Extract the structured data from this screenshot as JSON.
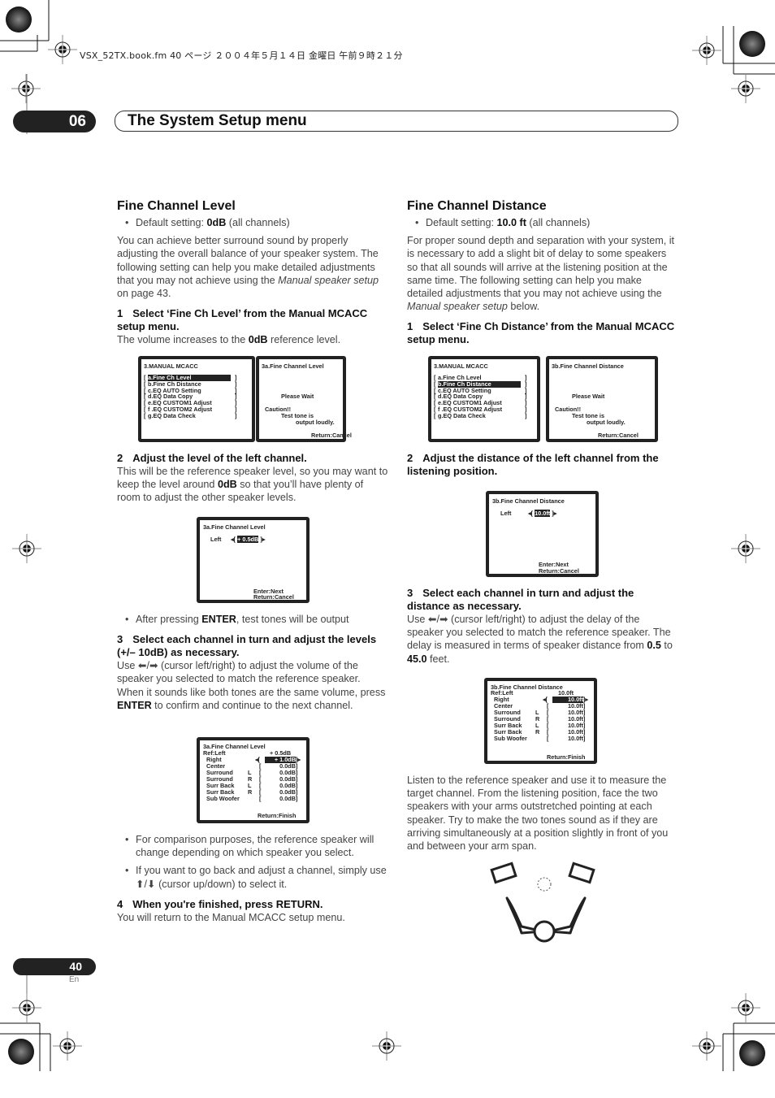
{
  "header": {
    "file_line": "VSX_52TX.book.fm  40 ページ  ２００４年５月１４日  金曜日  午前９時２１分",
    "chapter_number": "06",
    "chapter_title": "The System Setup menu"
  },
  "left": {
    "heading": "Fine Channel Level",
    "default_prefix": "Default setting: ",
    "default_value": "0dB",
    "default_suffix": " (all channels)",
    "intro_a": "You can achieve better surround sound by properly adjusting the overall balance of your speaker system. The following setting can help you make detailed adjustments that you may not achieve using the ",
    "intro_link": "Manual speaker setup",
    "intro_b": " on page 43.",
    "step1_num": "1",
    "step1_title": "Select ‘Fine Ch Level’ from the Manual MCACC setup menu.",
    "step1_a": "The volume increases to the ",
    "step1_bold": "0dB",
    "step1_b": " reference level.",
    "step2_num": "2",
    "step2_title": "Adjust the level of the left channel.",
    "step2_a": "This will be the reference speaker level, so you may want to keep the level around ",
    "step2_bold": "0dB",
    "step2_b": " so that you’ll have plenty of room to adjust the other speaker levels.",
    "bullet_enter_a": "After pressing ",
    "bullet_enter_bold": "ENTER",
    "bullet_enter_b": ", test tones will be output",
    "step3_num": "3",
    "step3_title_a": "Select each channel in turn and adjust the levels ",
    "step3_title_range": "(+/– 10dB)",
    "step3_title_b": " as necessary.",
    "step3_a": "Use ⬅/➡ (cursor left/right) to adjust the volume of the speaker you selected to match the reference speaker. When it sounds like both tones are the same volume, press ",
    "step3_bold": "ENTER",
    "step3_b": " to confirm and continue to the next channel.",
    "bullet_compare": "For comparison purposes, the reference speaker will change depending on which speaker you select.",
    "bullet_goback": "If you want to go back and adjust a channel, simply use ⬆/⬇ (cursor up/down) to select it.",
    "step4_num": "4",
    "step4_title": "When you're finished, press RETURN.",
    "step4_text": "You will return to the Manual MCACC setup menu."
  },
  "right": {
    "heading": "Fine Channel Distance",
    "default_prefix": "Default setting: ",
    "default_value": "10.0 ft",
    "default_suffix": " (all channels)",
    "intro_a": "For proper sound depth and separation with your system, it is necessary to add a slight bit of delay to some speakers so that all sounds will arrive at the listening position at the same time. The following setting can help you make detailed adjustments that you may not achieve using the ",
    "intro_link": "Manual speaker setup",
    "intro_b": " below.",
    "step1_num": "1",
    "step1_title": "Select ‘Fine Ch Distance’ from the Manual MCACC setup menu.",
    "step2_num": "2",
    "step2_title": "Adjust the distance of the left channel from the listening position.",
    "step3_num": "3",
    "step3_title": "Select each channel in turn and adjust the distance as necessary.",
    "step3_a": "Use ⬅/➡ (cursor left/right) to adjust the delay of the speaker you selected to match the reference speaker. The delay is measured in terms of speaker distance from ",
    "step3_min": "0.5",
    "step3_to": " to ",
    "step3_max": "45.0",
    "step3_b": " feet.",
    "listen_text": "Listen to the reference speaker and use it to measure the target channel. From the listening position, face the two speakers with your arms outstretched pointing at each speaker. Try to make the two tones sound as if they are arriving simultaneously at a position slightly in front of you and between your arm span."
  },
  "osd": {
    "menu_title": "3.MANUAL MCACC",
    "menu_items": [
      "a.Fine Ch Level",
      "b.Fine Ch Distance",
      "c.EQ AUTO Setting",
      "d.EQ Data Copy",
      "e.EQ CUSTOM1 Adjust",
      "f .EQ CUSTOM2 Adjust",
      "g.EQ Data Check"
    ],
    "level_title": "3a.Fine Channel Level",
    "distance_title": "3b.Fine Channel Distance",
    "please_wait": "Please Wait",
    "caution": "Caution!!",
    "test_tone": "Test tone is",
    "output_loudly": "output loudly.",
    "return_cancel": "Return:Cancel",
    "enter_next": "Enter:Next",
    "return_finish": "Return:Finish",
    "left_label": "Left",
    "left_level_value": "+ 0.5dB",
    "left_distance_value": "10.0ft",
    "ref_label": "Ref:Left",
    "ref_level": "+ 0.5dB",
    "ref_distance": "10.0ft",
    "channels": [
      {
        "name": "Right",
        "side": "",
        "level": "+ 1.0dB",
        "distance": "10.0ft"
      },
      {
        "name": "Center",
        "side": "",
        "level": "0.0dB",
        "distance": "10.0ft"
      },
      {
        "name": "Surround",
        "side": "L",
        "level": "0.0dB",
        "distance": "10.0ft"
      },
      {
        "name": "Surround",
        "side": "R",
        "level": "0.0dB",
        "distance": "10.0ft"
      },
      {
        "name": "Surr Back",
        "side": "L",
        "level": "0.0dB",
        "distance": "10.0ft"
      },
      {
        "name": "Surr Back",
        "side": "R",
        "level": "0.0dB",
        "distance": "10.0ft"
      },
      {
        "name": "Sub Woofer",
        "side": "",
        "level": "0.0dB",
        "distance": "10.0ft"
      }
    ]
  },
  "footer": {
    "page_number": "40",
    "language": "En"
  }
}
